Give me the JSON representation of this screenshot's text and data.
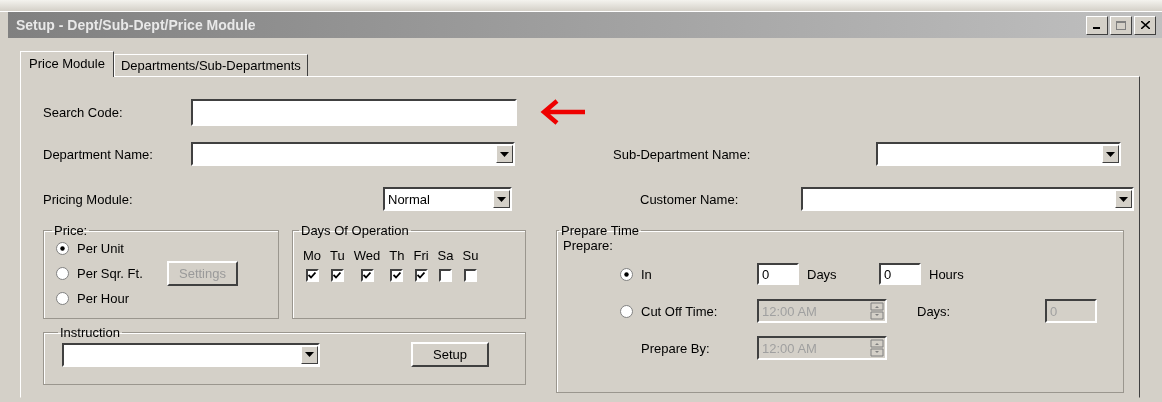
{
  "window": {
    "title": "Setup - Dept/Sub-Dept/Price Module"
  },
  "tabs": [
    {
      "label": "Price Module",
      "selected": true
    },
    {
      "label": "Departments/Sub-Departments",
      "selected": false
    }
  ],
  "search_code": {
    "label": "Search Code:"
  },
  "department": {
    "label": "Department Name:"
  },
  "sub_department": {
    "label": "Sub-Department Name:"
  },
  "pricing_module": {
    "label": "Pricing Module:",
    "value": "Normal"
  },
  "customer": {
    "label": "Customer Name:"
  },
  "price": {
    "title": "Price:",
    "options": [
      {
        "label": "Per Unit",
        "selected": true
      },
      {
        "label": "Per Sqr. Ft.",
        "selected": false
      },
      {
        "label": "Per Hour",
        "selected": false
      }
    ],
    "settings_button": {
      "label": "Settings",
      "disabled": true
    }
  },
  "days_of_operation": {
    "title": "Days Of Operation",
    "days": [
      {
        "label": "Mo",
        "checked": true
      },
      {
        "label": "Tu",
        "checked": true
      },
      {
        "label": "Wed",
        "checked": true
      },
      {
        "label": "Th",
        "checked": true
      },
      {
        "label": "Fri",
        "checked": true
      },
      {
        "label": "Sa",
        "checked": false
      },
      {
        "label": "Su",
        "checked": false
      }
    ]
  },
  "instruction": {
    "title": "Instruction",
    "setup_button": "Setup"
  },
  "prepare_time": {
    "title": "Prepare Time",
    "prepare_label": "Prepare:",
    "in": {
      "label": "In",
      "selected": true,
      "days_value": "0",
      "days_label": "Days",
      "hours_value": "0",
      "hours_label": "Hours"
    },
    "cut_off": {
      "label": "Cut Off Time:",
      "selected": false,
      "time": "12:00 AM",
      "disabled": true,
      "days_label": "Days:",
      "days_value": "0"
    },
    "prepare_by": {
      "label": "Prepare By:",
      "time": "12:00 AM",
      "disabled": true
    }
  }
}
